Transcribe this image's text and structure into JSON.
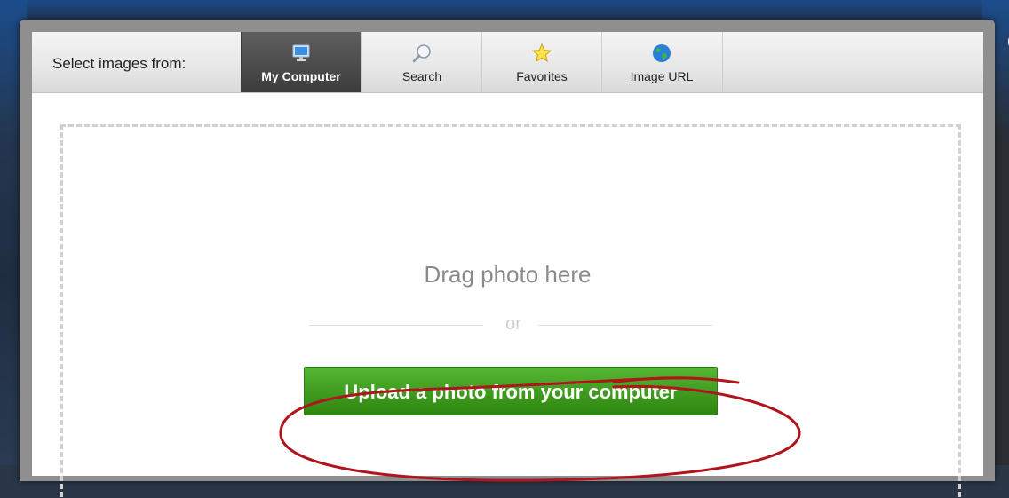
{
  "dialog": {
    "select_label": "Select images from:",
    "tabs": [
      {
        "label": "My Computer",
        "icon": "monitor-icon",
        "active": true
      },
      {
        "label": "Search",
        "icon": "magnifier-icon",
        "active": false
      },
      {
        "label": "Favorites",
        "icon": "star-icon",
        "active": false
      },
      {
        "label": "Image URL",
        "icon": "globe-icon",
        "active": false
      }
    ],
    "close_icon": "close-icon"
  },
  "dropzone": {
    "drag_text": "Drag photo here",
    "or_text": "or",
    "upload_button": "Upload a photo from your computer"
  },
  "colors": {
    "upload_button": "#3f9a1e",
    "annotation": "#b0141d",
    "active_tab": "#4a4a4a"
  }
}
